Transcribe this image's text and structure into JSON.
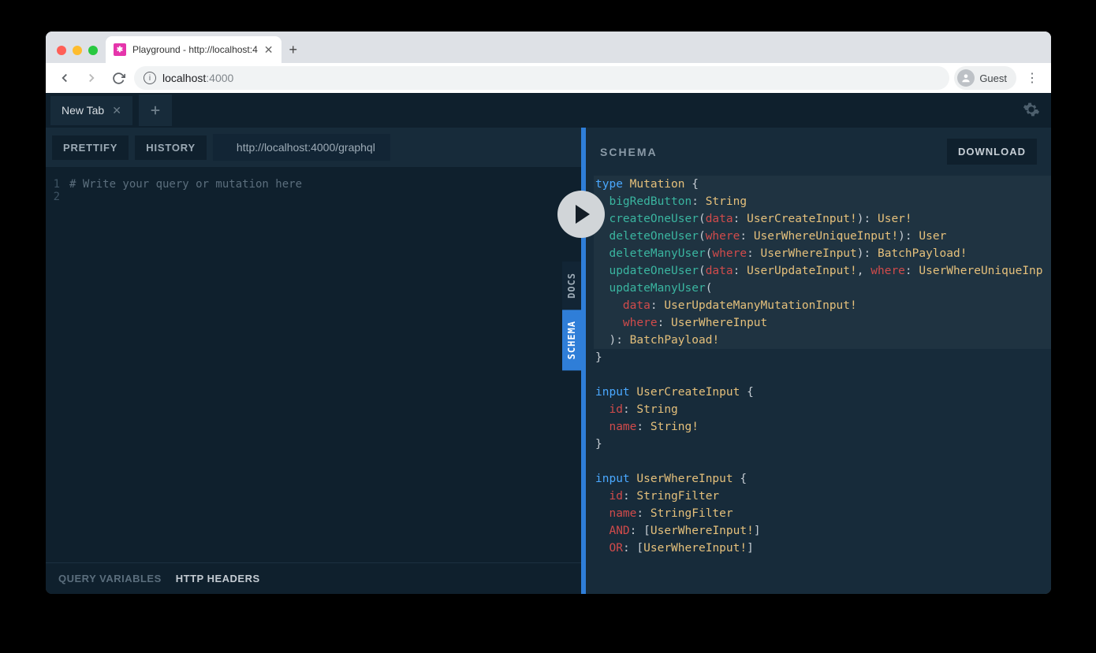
{
  "browser": {
    "tab_title": "Playground - http://localhost:4",
    "url_host": "localhost",
    "url_port": ":4000",
    "guest_label": "Guest"
  },
  "app": {
    "tab_label": "New Tab",
    "toolbar": {
      "prettify": "PRETTIFY",
      "history": "HISTORY",
      "endpoint": "http://localhost:4000/graphql"
    },
    "editor": {
      "placeholder_comment": "# Write your query or mutation here",
      "line1": "1",
      "line2": "2"
    },
    "side_tabs": {
      "docs": "DOCS",
      "schema": "SCHEMA"
    },
    "bottom": {
      "query_variables": "QUERY VARIABLES",
      "http_headers": "HTTP HEADERS"
    },
    "schema_panel": {
      "title": "SCHEMA",
      "download": "DOWNLOAD"
    }
  },
  "schema": {
    "kw_type": "type",
    "kw_input": "input",
    "mutation": "Mutation",
    "bigRedButton": "bigRedButton",
    "String": "String",
    "createOneUser": "createOneUser",
    "deleteOneUser": "deleteOneUser",
    "deleteManyUser": "deleteManyUser",
    "updateOneUser": "updateOneUser",
    "updateManyUser": "updateManyUser",
    "data": "data",
    "where": "where",
    "UserCreateInput": "UserCreateInput",
    "UserWhereUniqueInput": "UserWhereUniqueInput",
    "UserWhereInput": "UserWhereInput",
    "UserUpdateInput": "UserUpdateInput",
    "UserUpdateManyMutationInput": "UserUpdateManyMutationInput",
    "BatchPayload": "BatchPayload",
    "User": "User",
    "id": "id",
    "name": "name",
    "AND": "AND",
    "OR": "OR",
    "StringFilter": "StringFilter"
  }
}
